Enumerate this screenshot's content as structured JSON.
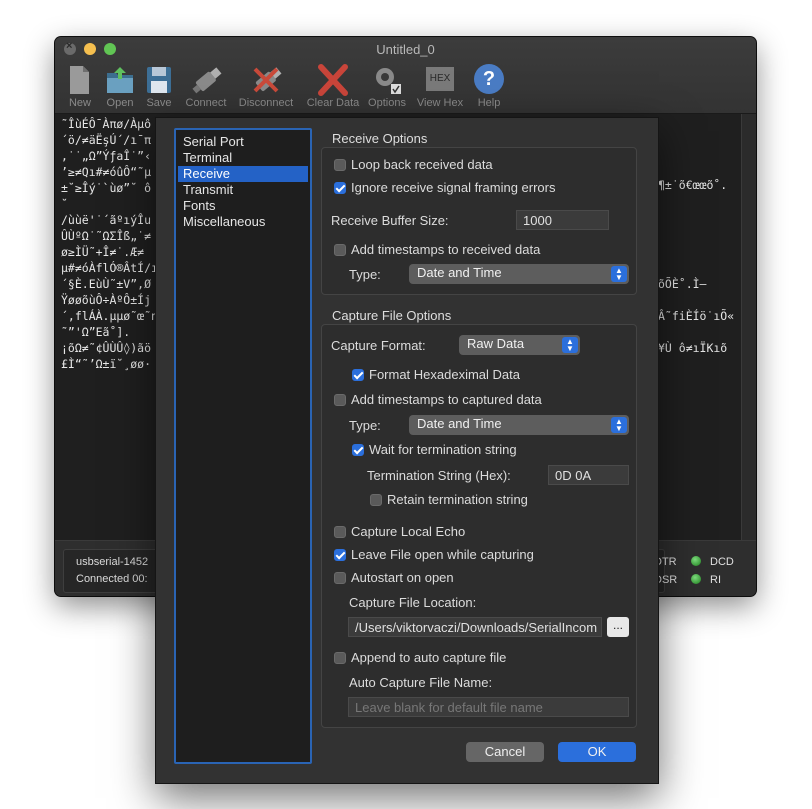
{
  "window": {
    "title": "Untitled_0"
  },
  "toolbar": {
    "new": "New",
    "open": "Open",
    "save": "Save",
    "connect": "Connect",
    "disconnect": "Disconnect",
    "clear_data": "Clear Data",
    "options": "Options",
    "view_hex": "View Hex",
    "help": "Help",
    "hex_icon_text": "HEX",
    "help_icon_text": "?"
  },
  "terminal": {
    "text": "˜ÎùÉÔ¯Àπø/Àµô\n´ö/≠äËşÚ´/ı¯π\n,˙˙„Ω”ÝƒaÎ˙”‹\n’≥≠Qı#≠óûÔ“˜µ\n±˘≥Îý˙`ùø”˘ ô\n˘\n/ùùë'˙´ãºıýÎu\nÛÙºΩ˙˜ΩΣÎß„˙≠\nø≥ÌÜ˜+Î≠˙.Æ≠\nµ#≠óÀflÓ®ÂtÍ/ı\n´§È.EùÙ˜±V”,Ø\nŸøøõùÔ÷ÀºÔ±Íj\n´,flÁÀ.µµø˜œ˜n\n˜”'Ω”Eã˚].\n¡õΩ≠˜¢ÛÙÛ◊)ãö\n£Ì“˜’Ω±ï˘¸øø·",
    "right_fragments": [
      "¶±˙õ€œœõ˚.",
      "õÕÈ˚.Ì–",
      "Â˜fiÈÍö˙ıÕ«",
      "¥Ù ô≠ıÏKıõ"
    ]
  },
  "statusbar": {
    "port": "usbserial-1452",
    "connection": "Connected 00:",
    "signals": [
      "DTR",
      "DCD",
      "DSR",
      "RI"
    ]
  },
  "sheet": {
    "sidebar": [
      {
        "label": "Serial Port",
        "selected": false
      },
      {
        "label": "Terminal",
        "selected": false
      },
      {
        "label": "Receive",
        "selected": true
      },
      {
        "label": "Transmit",
        "selected": false
      },
      {
        "label": "Fonts",
        "selected": false
      },
      {
        "label": "Miscellaneous",
        "selected": false
      }
    ],
    "receive_options": {
      "title": "Receive Options",
      "loop_back": {
        "label": "Loop back received data",
        "checked": false
      },
      "ignore_framing": {
        "label": "Ignore receive signal framing errors",
        "checked": true
      },
      "buffer_label": "Receive Buffer Size:",
      "buffer_value": "1000",
      "timestamps": {
        "label": "Add timestamps to received data",
        "checked": false
      },
      "type_label": "Type:",
      "type_value": "Date and Time"
    },
    "capture_options": {
      "title": "Capture File Options",
      "format_label": "Capture Format:",
      "format_value": "Raw Data",
      "format_hex": {
        "label": "Format Hexadeximal Data",
        "checked": true
      },
      "timestamps": {
        "label": "Add timestamps to captured data",
        "checked": false
      },
      "type_label": "Type:",
      "type_value": "Date and Time",
      "wait_termination": {
        "label": "Wait for termination string",
        "checked": true
      },
      "termination_label": "Termination String (Hex):",
      "termination_value": "0D 0A",
      "retain_termination": {
        "label": "Retain termination string",
        "checked": false
      },
      "local_echo": {
        "label": "Capture Local Echo",
        "checked": false
      },
      "leave_open": {
        "label": "Leave File open while capturing",
        "checked": true
      },
      "autostart": {
        "label": "Autostart on open",
        "checked": false
      },
      "location_label": "Capture File Location:",
      "location_value": "/Users/viktorvaczi/Downloads/SerialIncom",
      "browse_label": "...",
      "append_auto": {
        "label": "Append to auto capture file",
        "checked": false
      },
      "auto_name_label": "Auto Capture File Name:",
      "auto_name_placeholder": "Leave blank for default file name"
    },
    "cancel_label": "Cancel",
    "ok_label": "OK"
  }
}
